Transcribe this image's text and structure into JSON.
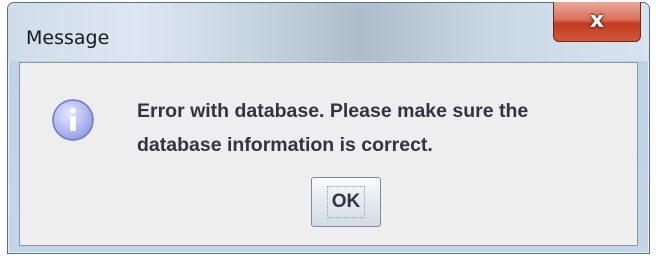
{
  "dialog": {
    "title": "Message",
    "close_glyph": "x",
    "icon": "information-icon",
    "message_lines": [
      "Error with database. Please make sure the",
      "database information is correct."
    ],
    "ok_label": "OK"
  },
  "colors": {
    "close_button": "#c94a30",
    "client_background": "#eeeeee",
    "text": "#333344",
    "icon_fill": "#a9b3f0"
  }
}
